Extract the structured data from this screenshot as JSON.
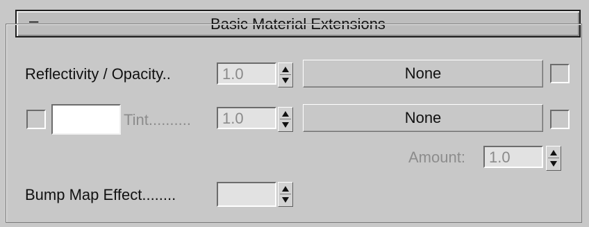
{
  "header": {
    "collapse_icon": "minus-icon",
    "collapse_sign": "–",
    "title": "Basic Material Extensions"
  },
  "reflectivity": {
    "label": "Reflectivity / Opacity..",
    "value": "1.0",
    "map_label": "None",
    "enabled": false
  },
  "tint": {
    "label": "Tint..........",
    "value": "1.0",
    "map_label": "None",
    "enabled": false,
    "color": "#ffffff"
  },
  "amount": {
    "label": "Amount:",
    "value": "1.0"
  },
  "bump": {
    "label": "Bump Map Effect........",
    "value": ""
  },
  "colors": {
    "panel_bg": "#c8c8c8",
    "disabled_text": "#8c8c8c",
    "swatch_color": "#ffffff"
  }
}
